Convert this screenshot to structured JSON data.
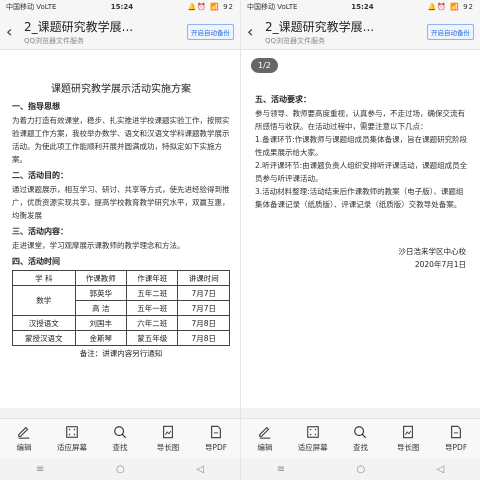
{
  "left": {
    "status": {
      "carrier": "中国移动 VoLTE",
      "time": "15:24",
      "icons": "🔔⏰ 📶 92"
    },
    "header": {
      "title": "2_课题研究教学展...",
      "subtitle": "QQ浏览器文件服务",
      "backup_label": "开启自动备份"
    },
    "doc": {
      "title": "课题研究教学展示活动实施方案",
      "s1_head": "一、指导思想",
      "s1_body": "为着力打造有效课堂，稳步、扎实推进学校课题实验工作，按照实验课题工作方案，我校举办数学、语文和汉语文学科课题教学展示活动。为使此项工作能顺利开展并圆满成功，特拟定如下实施方案。",
      "s2_head": "二、活动目的：",
      "s2_body": "通过课题展示，相互学习、研讨、共享等方式，使先进经验得到推广，优质资源实现共享，提高学校教育教学研究水平，双赢互惠，均衡发展",
      "s3_head": "三、活动内容：",
      "s3_body": "走进课堂，学习观摩展示课教师的教学理念和方法。",
      "s4_head": "四、活动时间",
      "table": {
        "headers": [
          "学 科",
          "作课教师",
          "作课年班",
          "讲课时间"
        ],
        "rows": [
          [
            "数学",
            "郭英华",
            "五年二班",
            "7月7日"
          ],
          [
            "",
            "高  洁",
            "五年一班",
            "7月7日"
          ],
          [
            "汉授语文",
            "刘国丰",
            "六年二班",
            "7月8日"
          ],
          [
            "蒙授汉语文",
            "金斯琴",
            "蒙五年级",
            "7月8日"
          ]
        ]
      },
      "note": "备注：讲课内容另行通知"
    }
  },
  "right": {
    "status": {
      "carrier": "中国移动 VoLTE",
      "time": "15:24",
      "icons": "🔔⏰ 📶 92"
    },
    "header": {
      "title": "2_课题研究教学展...",
      "subtitle": "QQ浏览器文件服务",
      "backup_label": "开启自动备份"
    },
    "pager": "1/2",
    "doc": {
      "s5_head": "五、活动要求：",
      "p1": "参与领导、教师要高度重视，认真参与，不走过场，确保交流有所感悟与收获。在活动过程中，需要注意以下几点：",
      "p2": "1.备课环节:作课教师与课题组成员集体备课，旨在课题研究阶段性成果展示给大家。",
      "p3": "2.听评课环节:由课题负责人组织安排听评课活动，课题组成员全员参与听评课活动。",
      "p4": "3.活动材料整理:活动结束后作课教师的教案（电子版）、课题组集体备课记录（纸质版）、评课记录（纸质版）交教导处备案。",
      "sign_school": "沙日浩来学区中心校",
      "sign_date": "2020年7月1日"
    }
  },
  "toolbar": [
    "编辑",
    "适应屏幕",
    "查找",
    "导长图",
    "导PDF"
  ]
}
